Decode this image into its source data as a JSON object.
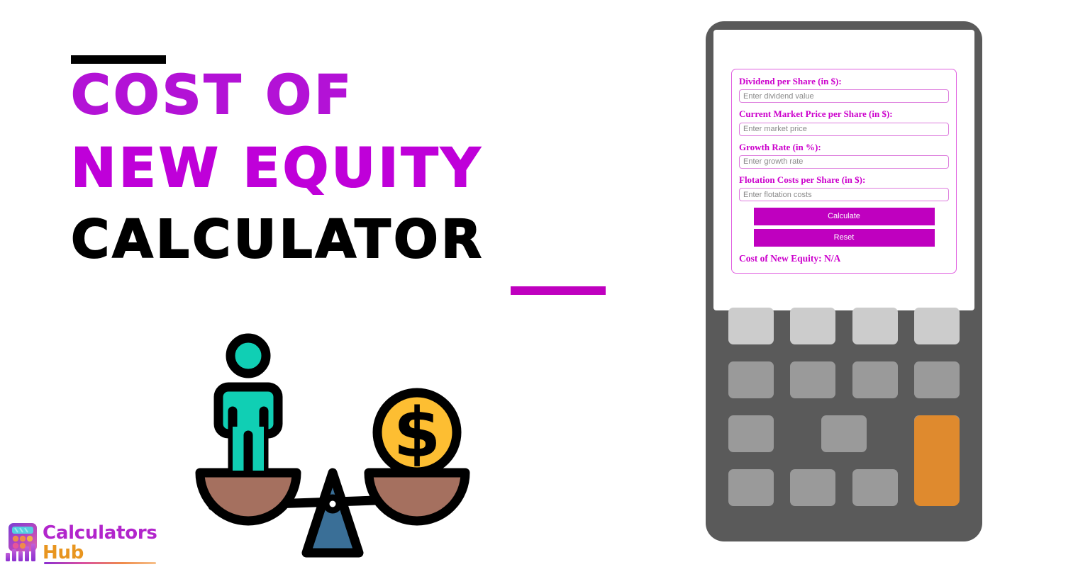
{
  "promo": {
    "title_line_1": "COST OF",
    "title_line_2": "NEW EQUITY",
    "title_line_3": "CALCULATOR",
    "accent_color": "#bf00bf",
    "title_purple": "#b312d6",
    "title_black": "#000000"
  },
  "illustration": {
    "name": "balance-scale-person-coin",
    "person_color": "#10cfb4",
    "coin_color": "#fdbe32",
    "pan_color": "#a5705f",
    "fulcrum_color": "#3a6f97",
    "outline_color": "#000000",
    "coin_symbol": "$"
  },
  "logo": {
    "word_1": "Calculators",
    "word_2": "Hub",
    "word_1_color": "#b225cc",
    "word_2_color": "#e8951f"
  },
  "device": {
    "body_color": "#5a5a5a",
    "screen_color": "#ffffff",
    "keypad": {
      "rows": [
        [
          {
            "shade": "light"
          },
          {
            "shade": "light"
          },
          {
            "shade": "light"
          },
          {
            "shade": "light"
          }
        ],
        [
          {
            "shade": "medium"
          },
          {
            "shade": "medium"
          },
          {
            "shade": "medium"
          },
          {
            "shade": "medium"
          }
        ],
        [
          {
            "shade": "medium"
          },
          {
            "shade": "medium"
          },
          {
            "shade": "medium"
          },
          {
            "shade": "orange-tall"
          }
        ],
        [
          {
            "shade": "medium"
          },
          {
            "shade": "medium"
          },
          {
            "shade": "medium"
          },
          {
            "shade": "spacer"
          }
        ]
      ],
      "light_color": "#cccccc",
      "medium_color": "#9a9a9a",
      "orange_color": "#df8a2e"
    }
  },
  "calculator_form": {
    "label_color": "#cc00cc",
    "border_color": "#e060e0",
    "button_color": "#bf00bf",
    "fields": [
      {
        "label": "Dividend per Share (in $):",
        "placeholder": "Enter dividend value",
        "value": ""
      },
      {
        "label": "Current Market Price per Share (in $):",
        "placeholder": "Enter market price",
        "value": ""
      },
      {
        "label": "Growth Rate (in %):",
        "placeholder": "Enter growth rate",
        "value": ""
      },
      {
        "label": "Flotation Costs per Share (in $):",
        "placeholder": "Enter flotation costs",
        "value": ""
      }
    ],
    "calculate_label": "Calculate",
    "reset_label": "Reset",
    "result_text": "Cost of New Equity: N/A"
  }
}
